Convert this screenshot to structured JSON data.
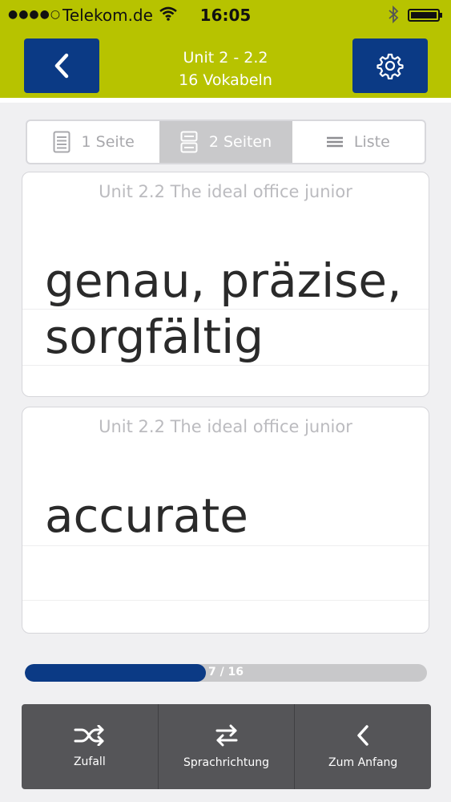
{
  "status_bar": {
    "signal": "●●●●○",
    "carrier": "Telekom.de",
    "time": "16:05"
  },
  "header": {
    "title": "Unit 2 - 2.2",
    "subtitle": "16 Vokabeln",
    "back_icon": "chevron-left-icon",
    "settings_icon": "gear-icon",
    "background_color": "#b7c300",
    "button_color": "#0b3a85"
  },
  "view_modes": [
    {
      "label": "1 Seite",
      "icon": "single-page-icon",
      "active": false
    },
    {
      "label": "2 Seiten",
      "icon": "two-pages-icon",
      "active": true
    },
    {
      "label": "Liste",
      "icon": "list-icon",
      "active": false
    }
  ],
  "cards": [
    {
      "unit": "Unit 2.2 The ideal office junior",
      "word": "genau, präzise, sorgfältig"
    },
    {
      "unit": "Unit 2.2 The ideal office junior",
      "word": "accurate"
    }
  ],
  "progress": {
    "current": 7,
    "total": 16,
    "text": "7 / 16",
    "fill_fraction": 0.45,
    "color": "#0b3a85"
  },
  "toolbar": [
    {
      "label": "Zufall",
      "icon": "shuffle-icon"
    },
    {
      "label": "Sprachrichtung",
      "icon": "swap-arrows-icon"
    },
    {
      "label": "Zum Anfang",
      "icon": "chevron-left-icon"
    }
  ]
}
